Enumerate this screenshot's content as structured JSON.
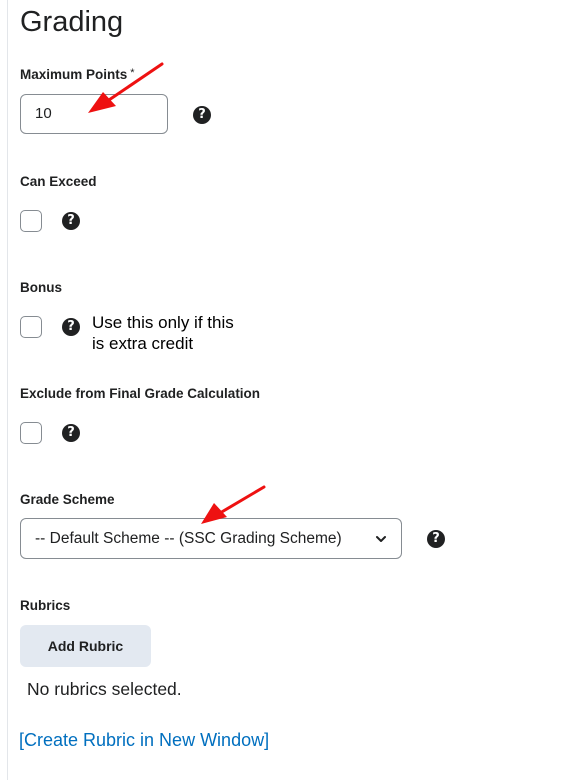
{
  "section_title": "Grading",
  "max_points": {
    "label": "Maximum Points",
    "required_mark": "*",
    "value": "10"
  },
  "can_exceed": {
    "label": "Can Exceed",
    "checked": false
  },
  "bonus": {
    "label": "Bonus",
    "checked": false,
    "annotation": [
      "Use this only if this",
      "is extra credit"
    ]
  },
  "exclude": {
    "label": "Exclude from Final Grade Calculation",
    "checked": false
  },
  "grade_scheme": {
    "label": "Grade Scheme",
    "selected": "-- Default Scheme -- (SSC Grading Scheme)"
  },
  "rubrics": {
    "label": "Rubrics",
    "add_button": "Add Rubric",
    "empty_text": "No rubrics selected.",
    "create_link": "[Create Rubric in New Window]"
  },
  "help_glyph": "?",
  "colors": {
    "link": "#006fbf",
    "annotation_arrow": "#ee1111",
    "button_bg": "#e3e9f1"
  }
}
